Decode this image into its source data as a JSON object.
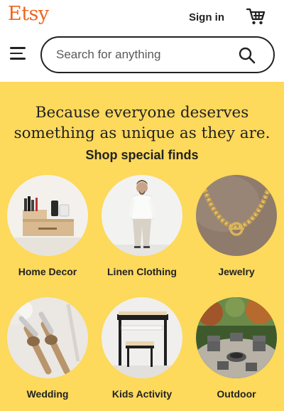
{
  "header": {
    "logo": "Etsy",
    "sign_in": "Sign in",
    "cart_icon": "cart-icon",
    "menu_icon": "hamburger-menu-icon"
  },
  "search": {
    "placeholder": "Search for anything",
    "icon": "search-icon"
  },
  "hero": {
    "headline_line1": "Because everyone deserves",
    "headline_line2": "something as unique as they are.",
    "subhead": "Shop special finds",
    "background": "#FDD95C"
  },
  "categories": [
    {
      "label": "Home Decor"
    },
    {
      "label": "Linen Clothing"
    },
    {
      "label": "Jewelry"
    },
    {
      "label": "Wedding"
    },
    {
      "label": "Kids Activity"
    },
    {
      "label": "Outdoor"
    }
  ],
  "colors": {
    "brand": "#F1641E",
    "text": "#222222"
  }
}
